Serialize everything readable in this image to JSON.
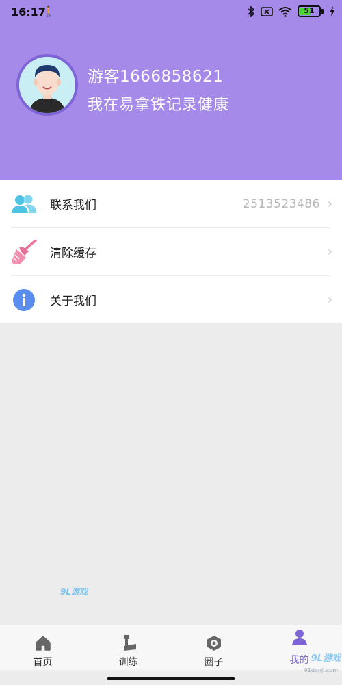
{
  "status_bar": {
    "time": "16:17",
    "battery": "51"
  },
  "profile": {
    "name": "游客1666858621",
    "subtitle": "我在易拿铁记录健康"
  },
  "menu": {
    "items": [
      {
        "label": "联系我们",
        "value": "2513523486",
        "icon": "contacts-icon"
      },
      {
        "label": "清除缓存",
        "value": "",
        "icon": "broom-icon"
      },
      {
        "label": "关于我们",
        "value": "",
        "icon": "info-icon"
      }
    ]
  },
  "tabs": [
    {
      "label": "首页",
      "icon": "home-icon",
      "active": false
    },
    {
      "label": "训练",
      "icon": "dumbbell-icon",
      "active": false
    },
    {
      "label": "圈子",
      "icon": "circle-hexagon-icon",
      "active": false
    },
    {
      "label": "我的",
      "icon": "user-icon",
      "active": true
    }
  ],
  "watermarks": {
    "middle": "9L游戏",
    "corner": "9L游戏",
    "corner_small": "91danji.com"
  },
  "colors": {
    "header_bg": "#a68aea",
    "accent": "#7d64d7",
    "contacts_icon": "#4fc3e6",
    "broom_icon": "#e8739a",
    "info_icon": "#5b8def"
  }
}
